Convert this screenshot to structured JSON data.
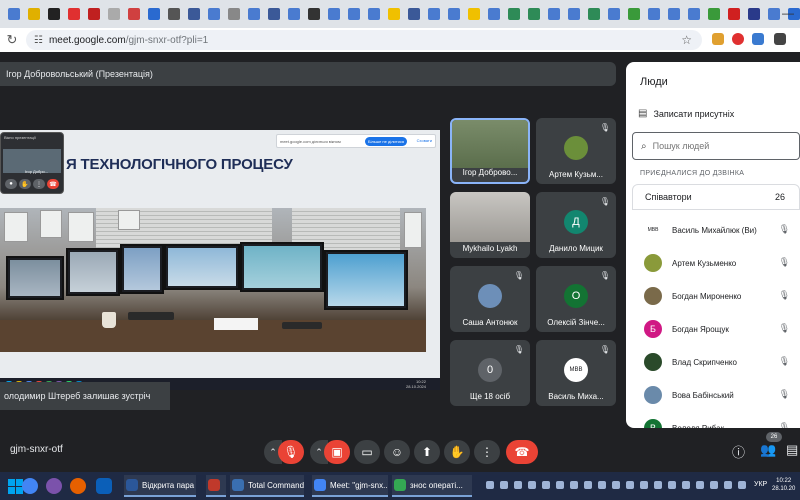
{
  "browser": {
    "url_host": "meet.google.com",
    "url_path": "/gjm-snxr-otf?pli=1"
  },
  "meet": {
    "presenter_label": "Ігор Добровольський (Презентація)",
    "slide_heading": "Я ТЕХНОЛОГІЧНОГО ПРОЦЕСУ",
    "share_banner_text": "meet.google.com ділиться вікном",
    "share_stop_label": "Більше не ділитися",
    "share_hide_label": "Сховати",
    "inner_clock_time": "10:22",
    "inner_clock_date": "28.10.2024",
    "mini_title": "Вікно презентації",
    "mini_name": "Ігор Добро...",
    "leave_toast": "олодимир Штереб залишає зустріч",
    "meeting_code": "gjm-snxr-otf",
    "people_badge_count": "26"
  },
  "tiles": [
    {
      "name": "Ігор Доброво...",
      "initial": "",
      "color": "",
      "speaking": true
    },
    {
      "name": "Артем Кузьм...",
      "initial": "",
      "color": "#6b8f3a",
      "speaking": false
    },
    {
      "name": "Mykhailo Lyakh",
      "initial": "",
      "color": "",
      "speaking": false
    },
    {
      "name": "Данило Мицик",
      "initial": "Д",
      "color": "#12866f",
      "speaking": false
    },
    {
      "name": "Саша Антонюк",
      "initial": "",
      "color": "#6d8fb8",
      "speaking": false
    },
    {
      "name": "Олексій Зінче...",
      "initial": "О",
      "color": "#137333",
      "speaking": false
    },
    {
      "name": "Ще 18 осіб",
      "initial": "0",
      "color": "#5f6368",
      "speaking": false
    },
    {
      "name": "Василь Миха...",
      "initial": "МВВ",
      "color": "#ffffff",
      "speaking": false
    }
  ],
  "people_panel": {
    "title": "Люди",
    "record_label": "Записати присутніх",
    "search_placeholder": "Пошук людей",
    "section_label": "ПРИЄДНАЛИСЯ ДО ДЗВІНКА",
    "group_label": "Співавтори",
    "group_count": "26",
    "people": [
      {
        "name": "Василь Михайлюк (Ви)",
        "initial": "МВВ",
        "color": "#ffffff"
      },
      {
        "name": "Артем Кузьменко",
        "initial": "",
        "color": "#8a9a3a"
      },
      {
        "name": "Богдан Мироненко",
        "initial": "",
        "color": "#7a6a4a"
      },
      {
        "name": "Богдан Ярощук",
        "initial": "Б",
        "color": "#d01884"
      },
      {
        "name": "Влад Скрипченко",
        "initial": "",
        "color": "#2a4a2a"
      },
      {
        "name": "Вова Бабінський",
        "initial": "",
        "color": "#6a8aaa"
      },
      {
        "name": "Володя Рибак",
        "initial": "В",
        "color": "#137333"
      }
    ]
  },
  "taskbar": {
    "apps": [
      {
        "label": "Відкрита пара ...",
        "color": "#2b579a"
      },
      {
        "label": "",
        "color": "#c0392b"
      },
      {
        "label": "Total Command...",
        "color": "#3a6fb0"
      },
      {
        "label": "Meet: \"gjm-snx...",
        "color": "#4285f4"
      },
      {
        "label": "знос операті...",
        "color": "#34a853"
      }
    ],
    "lang": "УКР",
    "time": "10:22",
    "date": "28.10.20"
  }
}
